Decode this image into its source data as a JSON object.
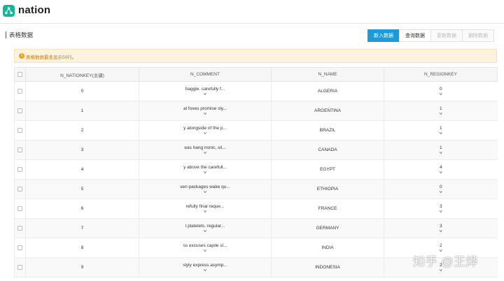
{
  "app": {
    "title": "nation",
    "logo_icon": "cluster-icon",
    "brand_color": "#17b597"
  },
  "section": {
    "title": "表格数据"
  },
  "toolbar": {
    "insert_label": "新入数据",
    "query_label": "查询数据",
    "update_label": "更新数据",
    "delete_label": "删除数据",
    "accent_color": "#1e9ad6"
  },
  "notice": {
    "text": "表格数据最多显示50行。",
    "icon": "warning-icon"
  },
  "table": {
    "columns": [
      "N_NATIONKEY(主键)",
      "N_COMMENT",
      "N_NAME",
      "N_REGIONKEY"
    ],
    "rows": [
      {
        "key": "0",
        "comment": "haggle. carefully f...",
        "name": "ALGERIA",
        "region": "0"
      },
      {
        "key": "1",
        "comment": "al foxes promise sly...",
        "name": "ARGENTINA",
        "region": "1"
      },
      {
        "key": "2",
        "comment": "y alongside of the p...",
        "name": "BRAZIL",
        "region": "1"
      },
      {
        "key": "3",
        "comment": "eas hang ironic, sil...",
        "name": "CANADA",
        "region": "1"
      },
      {
        "key": "4",
        "comment": "y above the carefull...",
        "name": "EGYPT",
        "region": "4"
      },
      {
        "key": "5",
        "comment": "ven packages wake qu...",
        "name": "ETHIOPIA",
        "region": "0"
      },
      {
        "key": "6",
        "comment": "refully final reque...",
        "name": "FRANCE",
        "region": "3"
      },
      {
        "key": "7",
        "comment": "l platelets. regular...",
        "name": "GERMANY",
        "region": "3"
      },
      {
        "key": "8",
        "comment": "ss excuses cajole sl...",
        "name": "INDIA",
        "region": "2"
      },
      {
        "key": "9",
        "comment": "slyly express asymp...",
        "name": "INDONESIA",
        "region": "2"
      }
    ]
  },
  "watermark": {
    "text": "知乎 @王烨"
  }
}
